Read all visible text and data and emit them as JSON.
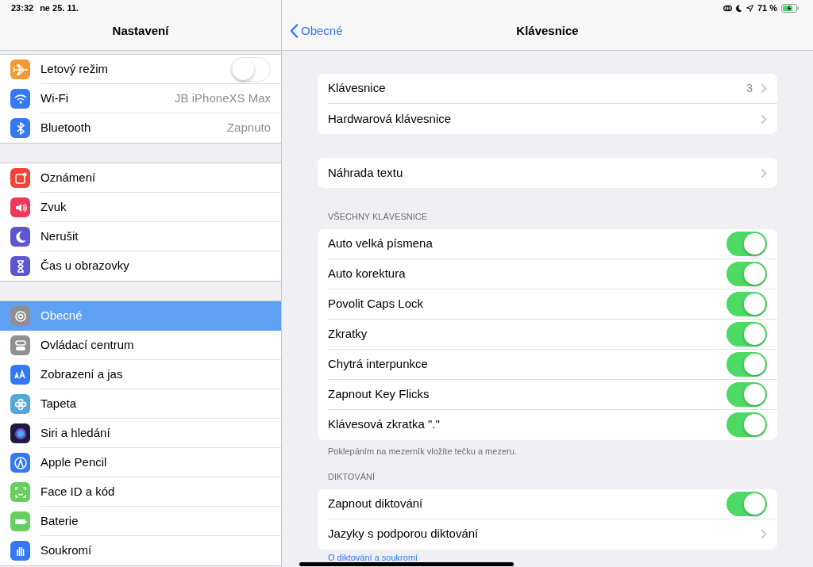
{
  "status_bar": {
    "time": "23:32",
    "date": "ne 25. 11.",
    "battery": "71 %"
  },
  "sidebar": {
    "title": "Nastavení",
    "groups": [
      [
        {
          "label": "Letový režim",
          "kind": "toggle",
          "on": false,
          "selected": false
        },
        {
          "label": "Wi-Fi",
          "kind": "value",
          "value": "JB iPhoneXS Max",
          "selected": false
        },
        {
          "label": "Bluetooth",
          "kind": "value",
          "value": "Zapnuto",
          "selected": false
        }
      ],
      [
        {
          "label": "Oznámení",
          "kind": "plain",
          "selected": false
        },
        {
          "label": "Zvuk",
          "kind": "plain",
          "selected": false
        },
        {
          "label": "Nerušit",
          "kind": "plain",
          "selected": false
        },
        {
          "label": "Čas u obrazovky",
          "kind": "plain",
          "selected": false
        }
      ],
      [
        {
          "label": "Obecné",
          "kind": "plain",
          "selected": true
        },
        {
          "label": "Ovládací centrum",
          "kind": "plain",
          "selected": false
        },
        {
          "label": "Zobrazení a jas",
          "kind": "plain",
          "selected": false
        },
        {
          "label": "Tapeta",
          "kind": "plain",
          "selected": false
        },
        {
          "label": "Siri a hledání",
          "kind": "plain",
          "selected": false
        },
        {
          "label": "Apple Pencil",
          "kind": "plain",
          "selected": false
        },
        {
          "label": "Face ID a kód",
          "kind": "plain",
          "selected": false
        },
        {
          "label": "Baterie",
          "kind": "plain",
          "selected": false
        },
        {
          "label": "Soukromí",
          "kind": "plain",
          "selected": false
        }
      ]
    ]
  },
  "detail": {
    "back": "Obecné",
    "title": "Klávesnice",
    "sections": [
      {
        "rows": [
          {
            "label": "Klávesnice",
            "kind": "chevron",
            "value": "3"
          },
          {
            "label": "Hardwarová klávesnice",
            "kind": "chevron"
          }
        ]
      },
      {
        "rows": [
          {
            "label": "Náhrada textu",
            "kind": "chevron"
          }
        ]
      },
      {
        "header": "VŠECHNY KLÁVESNICE",
        "rows": [
          {
            "label": "Auto velká písmena",
            "kind": "toggle",
            "on": true
          },
          {
            "label": "Auto korektura",
            "kind": "toggle",
            "on": true
          },
          {
            "label": "Povolit Caps Lock",
            "kind": "toggle",
            "on": true
          },
          {
            "label": "Zkratky",
            "kind": "toggle",
            "on": true
          },
          {
            "label": "Chytrá interpunkce",
            "kind": "toggle",
            "on": true
          },
          {
            "label": "Zapnout Key Flicks",
            "kind": "toggle",
            "on": true
          },
          {
            "label": "Klávesová zkratka \".\"",
            "kind": "toggle",
            "on": true
          }
        ],
        "footer": "Poklepáním na mezerník vložíte tečku a mezeru."
      },
      {
        "header": "DIKTOVÁNÍ",
        "rows": [
          {
            "label": "Zapnout diktování",
            "kind": "toggle",
            "on": true
          },
          {
            "label": "Jazyky s podporou diktování",
            "kind": "chevron"
          }
        ],
        "link": "O diktování a soukromí"
      }
    ]
  }
}
